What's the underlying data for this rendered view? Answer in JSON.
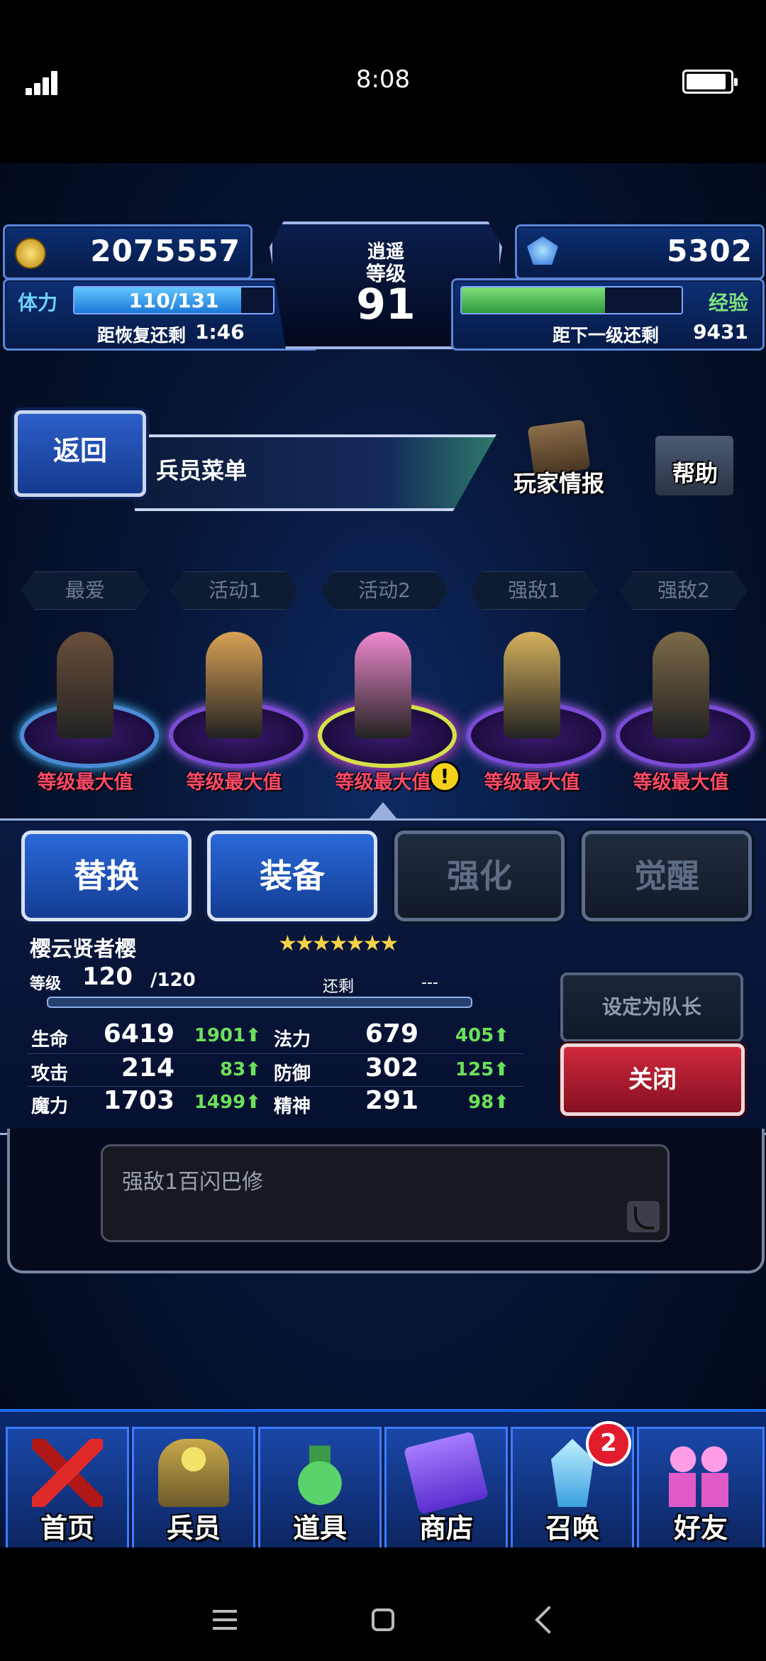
{
  "status_bar": {
    "time": "8:08",
    "icons": [
      "signal-icon",
      "battery-icon"
    ],
    "battery_level": 0.92
  },
  "hud": {
    "gil": "2075557",
    "gems": "5302",
    "title_small": "逍遥",
    "level_label": "等级",
    "level": "91",
    "stamina_label": "体力",
    "stamina": "110/131",
    "stamina_fraction": 0.84,
    "recover_label": "距恢复还剩",
    "recover_time": "1:46",
    "exp_label": "经验",
    "exp_fraction": 0.65,
    "next_label": "距下一级还剩",
    "next_value": "9431"
  },
  "header": {
    "back_label": "返回",
    "menu_title": "兵员菜单",
    "player_info_label": "玩家情报",
    "help_label": "帮助"
  },
  "party_tabs": [
    "最爱",
    "活动1",
    "活动2",
    "强敌1",
    "强敌2"
  ],
  "units_row": {
    "max_label": "等级最大值",
    "units": [
      {
        "name": "unit-1",
        "color": "#6a4f3a"
      },
      {
        "name": "unit-2",
        "color": "#d9a255"
      },
      {
        "name": "unit-3",
        "color": "#f08ad0"
      },
      {
        "name": "unit-4",
        "color": "#d6b25c"
      },
      {
        "name": "unit-5",
        "color": "#7d6a48"
      }
    ]
  },
  "actions": {
    "replace": "替换",
    "equip": "装备",
    "enhance": "强化",
    "awaken": "觉醒"
  },
  "unit_detail": {
    "name": "樱云贤者樱",
    "stars": "★★★★★★★",
    "level_label": "等级",
    "level": "120",
    "level_max": "/120",
    "remain_label": "还剩",
    "remain_value": "---",
    "stats": [
      {
        "name": "生命",
        "value": "6419",
        "bonus": "1901"
      },
      {
        "name": "攻击",
        "value": "214",
        "bonus": "83"
      },
      {
        "name": "魔力",
        "value": "1703",
        "bonus": "1499"
      }
    ],
    "stats_right": [
      {
        "name": "法力",
        "value": "679",
        "bonus": "405"
      },
      {
        "name": "防御",
        "value": "302",
        "bonus": "125"
      },
      {
        "name": "精神",
        "value": "291",
        "bonus": "98"
      }
    ],
    "set_leader_label": "设定为队长",
    "close_label": "关闭"
  },
  "note": {
    "text": "强敌1百闪巴修"
  },
  "bottom_nav": {
    "items": [
      "首页",
      "兵员",
      "道具",
      "商店",
      "召唤",
      "好友"
    ],
    "summon_badge": "2"
  },
  "colors": {
    "accent_blue": "#2a68d8",
    "close_red": "#d0283d",
    "stat_bonus_green": "#6be05a",
    "max_level_red": "#ff4a6a"
  }
}
